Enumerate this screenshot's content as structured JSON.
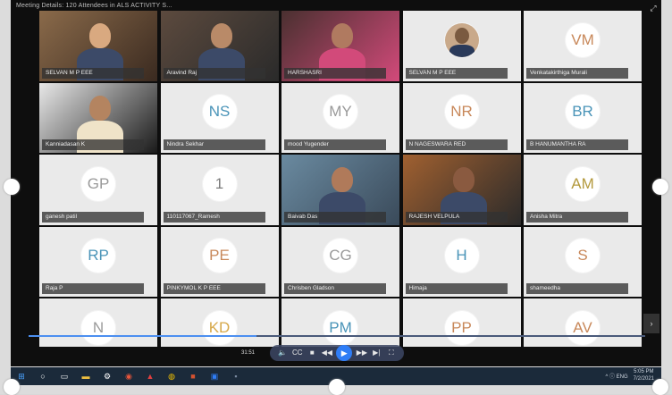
{
  "window": {
    "title": "Meeting Details: 120 Attendees in ALS ACTIVITY S..."
  },
  "participants": [
    {
      "name": "SELVAN M P EEE",
      "initials": "",
      "video": true
    },
    {
      "name": "Aravind Raj",
      "initials": "",
      "video": true
    },
    {
      "name": "HARSHASRI",
      "initials": "",
      "video": true
    },
    {
      "name": "SELVAN M P EEE",
      "initials": "",
      "video": false,
      "photo": true
    },
    {
      "name": "Venkatakirthiga Murali",
      "initials": "VM",
      "color": "#c8885a"
    },
    {
      "name": "Kanniadasan K",
      "initials": "",
      "video": true
    },
    {
      "name": "Nindra Sekhar",
      "initials": "NS",
      "color": "#4a94b8"
    },
    {
      "name": "mood Yugender",
      "initials": "MY",
      "color": "#9a9a9a"
    },
    {
      "name": "N NAGESWARA RED",
      "initials": "NR",
      "color": "#c8885a"
    },
    {
      "name": "B HANUMANTHA RA",
      "initials": "BR",
      "color": "#4a94b8"
    },
    {
      "name": "ganesh patil",
      "initials": "GP",
      "color": "#9a9a9a"
    },
    {
      "name": "110117067_Ramesh",
      "initials": "1",
      "color": "#7a7a7a"
    },
    {
      "name": "Baivab Das",
      "initials": "",
      "video": true
    },
    {
      "name": "RAJESH VELPULA",
      "initials": "",
      "video": true
    },
    {
      "name": "Anisha Mitra",
      "initials": "AM",
      "color": "#b49a3e"
    },
    {
      "name": "Raja P",
      "initials": "RP",
      "color": "#4a94b8"
    },
    {
      "name": "PINKYMOL K P EEE",
      "initials": "PE",
      "color": "#c8885a"
    },
    {
      "name": "Chrisben Gladson",
      "initials": "CG",
      "color": "#9a9a9a"
    },
    {
      "name": "Himaja",
      "initials": "H",
      "color": "#4a94b8"
    },
    {
      "name": "shameedha",
      "initials": "S",
      "color": "#c8885a"
    },
    {
      "name": "",
      "initials": "N",
      "color": "#9a9a9a"
    },
    {
      "name": "",
      "initials": "KD",
      "color": "#d6a84a"
    },
    {
      "name": "",
      "initials": "PM",
      "color": "#4a94b8"
    },
    {
      "name": "",
      "initials": "PP",
      "color": "#c8885a"
    },
    {
      "name": "",
      "initials": "AV",
      "color": "#c8885a"
    }
  ],
  "player": {
    "time_left": "31:51",
    "progress": 0.37,
    "controls": {
      "volume": "🔈",
      "cc": "CC",
      "stop": "■",
      "rewind": "◀◀",
      "play": "▶",
      "forward": "▶▶",
      "next": "▶|",
      "fullscreen": "⛶"
    }
  },
  "taskbar": {
    "tray_text": "^ ⓘ ENG",
    "tray_time": "5:05 PM",
    "tray_date": "7/2/2021"
  }
}
